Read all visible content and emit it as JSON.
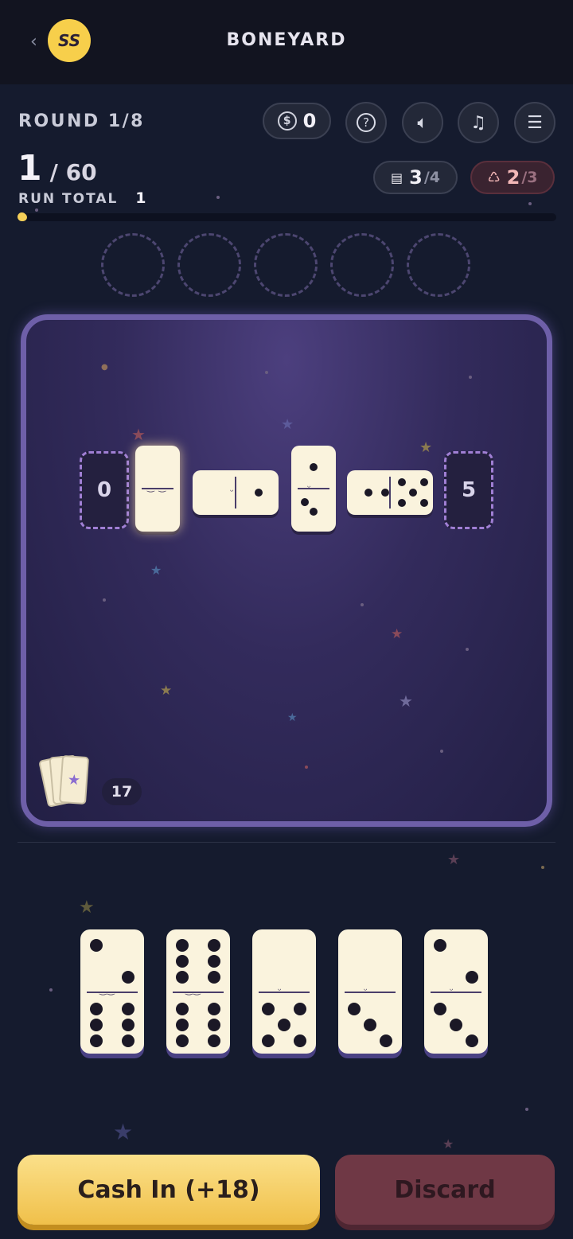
{
  "header": {
    "back_label": "‹",
    "avatar_initials": "SS",
    "title": "BONEYARD"
  },
  "status": {
    "round_label": "ROUND 1/8",
    "coins": "0",
    "score": "1",
    "target": "/ 60",
    "run_total_label": "RUN TOTAL",
    "run_total_value": "1",
    "progress_fraction": 0.017,
    "hands_left": "3",
    "hands_total": "/4",
    "discards_left": "2",
    "discards_total": "/3"
  },
  "toolbar": {
    "icons": [
      "coin-icon",
      "help-icon",
      "sound-icon",
      "music-icon",
      "menu-icon"
    ]
  },
  "chain": {
    "left_end": "0",
    "right_end": "5"
  },
  "deck": {
    "count": "17"
  },
  "actions": {
    "cash_in_label": "Cash In (+18)",
    "discard_label": "Discard"
  },
  "colors": {
    "accent_gold": "#f5cf58",
    "board_border": "#6e5fa8",
    "discard": "#6f3845"
  }
}
